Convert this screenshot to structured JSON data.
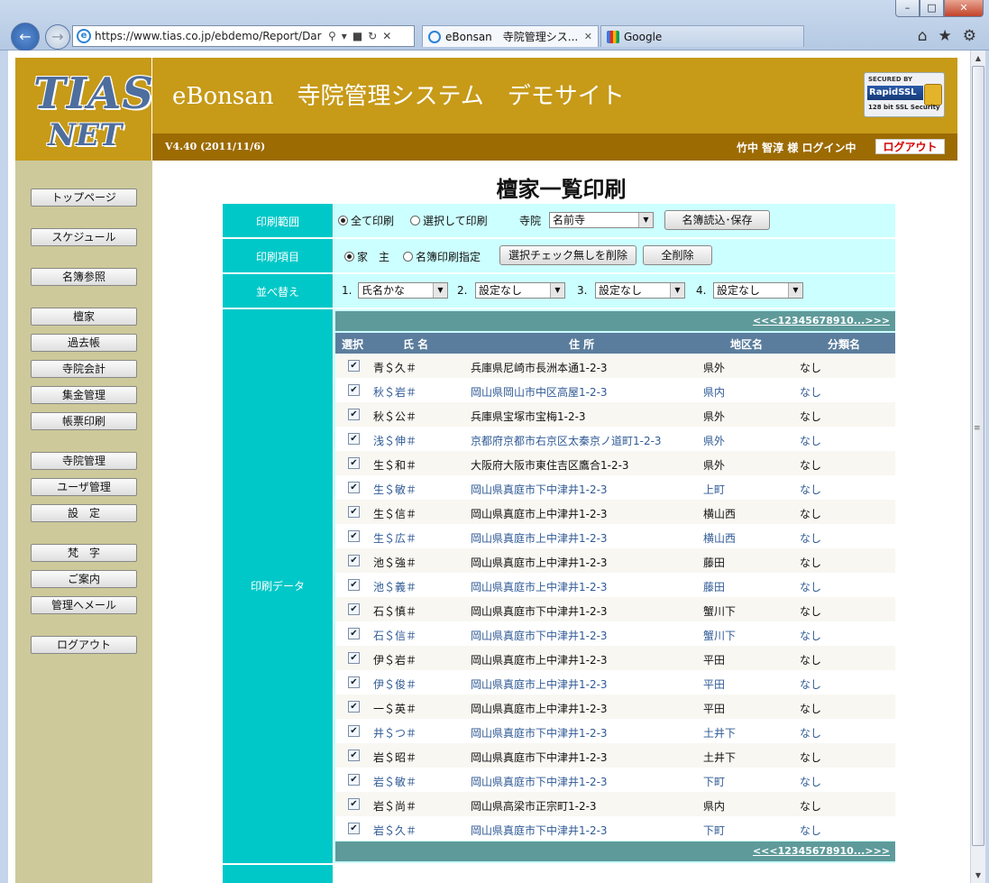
{
  "browser": {
    "url": "https://www.tias.co.jp/ebdemo/Report/Dar",
    "tabs": [
      {
        "label": "eBonsan　寺院管理シス..."
      },
      {
        "label": "Google"
      }
    ]
  },
  "header": {
    "logo_line1": "TIAS",
    "logo_line2": "NET",
    "site_title": "eBonsan　寺院管理システム　デモサイト",
    "ssl_secured_by": "SECURED BY",
    "ssl_brand": "RapidSSL",
    "ssl_strength": "128 bit SSL Security",
    "version": "V4.40 (2011/11/6)",
    "user_info": "竹中 智淳 様  ログイン中",
    "logout_label": "ログアウト"
  },
  "sidebar": {
    "items": [
      {
        "label": "トップページ"
      },
      {
        "label": "スケジュール"
      },
      {
        "label": "名簿参照"
      },
      {
        "label": "檀家"
      },
      {
        "label": "過去帳"
      },
      {
        "label": "寺院会計"
      },
      {
        "label": "集金管理"
      },
      {
        "label": "帳票印刷"
      },
      {
        "label": "寺院管理"
      },
      {
        "label": "ユーザ管理"
      },
      {
        "label": "設　定"
      },
      {
        "label": "梵　字"
      },
      {
        "label": "ご案内"
      },
      {
        "label": "管理へメール"
      },
      {
        "label": "ログアウト"
      }
    ]
  },
  "main": {
    "title": "檀家一覧印刷",
    "print_range": {
      "label": "印刷範囲",
      "option_all": "全て印刷",
      "option_selected": "選択して印刷",
      "selected_option": "全て印刷",
      "temple_label": "寺院",
      "temple_value": "名前寺",
      "load_save_button": "名簿読込･保存"
    },
    "print_items": {
      "label": "印刷項目",
      "option_head": "家　主",
      "option_custom": "名簿印刷指定",
      "selected_option": "家　主",
      "delete_unchecked_button": "選択チェック無しを削除",
      "delete_all_button": "全削除"
    },
    "sort": {
      "label": "並べ替え",
      "keys": [
        {
          "num": "1.",
          "value": "氏名かな"
        },
        {
          "num": "2.",
          "value": "設定なし"
        },
        {
          "num": "3.",
          "value": "設定なし"
        },
        {
          "num": "4.",
          "value": "設定なし"
        }
      ]
    },
    "data_label": "印刷データ",
    "pager_text": "<<<12345678910...>>>",
    "columns": {
      "select": "選択",
      "name": "氏 名",
      "address": "住 所",
      "area": "地区名",
      "category": "分類名"
    },
    "rows": [
      {
        "checked": true,
        "name": "青＄久＃",
        "address": "兵庫県尼崎市長洲本通1-2-3",
        "area": "県外",
        "category": "なし"
      },
      {
        "checked": true,
        "name": "秋＄岩＃",
        "address": "岡山県岡山市中区高屋1-2-3",
        "area": "県内",
        "category": "なし"
      },
      {
        "checked": true,
        "name": "秋＄公＃",
        "address": "兵庫県宝塚市宝梅1-2-3",
        "area": "県外",
        "category": "なし"
      },
      {
        "checked": true,
        "name": "浅＄伸＃",
        "address": "京都府京都市右京区太秦京ノ道町1-2-3",
        "area": "県外",
        "category": "なし"
      },
      {
        "checked": true,
        "name": "生＄和＃",
        "address": "大阪府大阪市東住吉区鷹合1-2-3",
        "area": "県外",
        "category": "なし"
      },
      {
        "checked": true,
        "name": "生＄敏＃",
        "address": "岡山県真庭市下中津井1-2-3",
        "area": "上町",
        "category": "なし"
      },
      {
        "checked": true,
        "name": "生＄信＃",
        "address": "岡山県真庭市上中津井1-2-3",
        "area": "横山西",
        "category": "なし"
      },
      {
        "checked": true,
        "name": "生＄広＃",
        "address": "岡山県真庭市上中津井1-2-3",
        "area": "横山西",
        "category": "なし"
      },
      {
        "checked": true,
        "name": "池＄強＃",
        "address": "岡山県真庭市上中津井1-2-3",
        "area": "藤田",
        "category": "なし"
      },
      {
        "checked": true,
        "name": "池＄義＃",
        "address": "岡山県真庭市上中津井1-2-3",
        "area": "藤田",
        "category": "なし"
      },
      {
        "checked": true,
        "name": "石＄慎＃",
        "address": "岡山県真庭市下中津井1-2-3",
        "area": "蟹川下",
        "category": "なし"
      },
      {
        "checked": true,
        "name": "石＄信＃",
        "address": "岡山県真庭市下中津井1-2-3",
        "area": "蟹川下",
        "category": "なし"
      },
      {
        "checked": true,
        "name": "伊＄岩＃",
        "address": "岡山県真庭市上中津井1-2-3",
        "area": "平田",
        "category": "なし"
      },
      {
        "checked": true,
        "name": "伊＄俊＃",
        "address": "岡山県真庭市上中津井1-2-3",
        "area": "平田",
        "category": "なし"
      },
      {
        "checked": true,
        "name": "一＄英＃",
        "address": "岡山県真庭市上中津井1-2-3",
        "area": "平田",
        "category": "なし"
      },
      {
        "checked": true,
        "name": "井＄つ＃",
        "address": "岡山県真庭市下中津井1-2-3",
        "area": "土井下",
        "category": "なし"
      },
      {
        "checked": true,
        "name": "岩＄昭＃",
        "address": "岡山県真庭市下中津井1-2-3",
        "area": "土井下",
        "category": "なし"
      },
      {
        "checked": true,
        "name": "岩＄敏＃",
        "address": "岡山県真庭市下中津井1-2-3",
        "area": "下町",
        "category": "なし"
      },
      {
        "checked": true,
        "name": "岩＄尚＃",
        "address": "岡山県高梁市正宗町1-2-3",
        "area": "県内",
        "category": "なし"
      },
      {
        "checked": true,
        "name": "岩＄久＃",
        "address": "岡山県真庭市下中津井1-2-3",
        "area": "下町",
        "category": "なし"
      }
    ]
  }
}
